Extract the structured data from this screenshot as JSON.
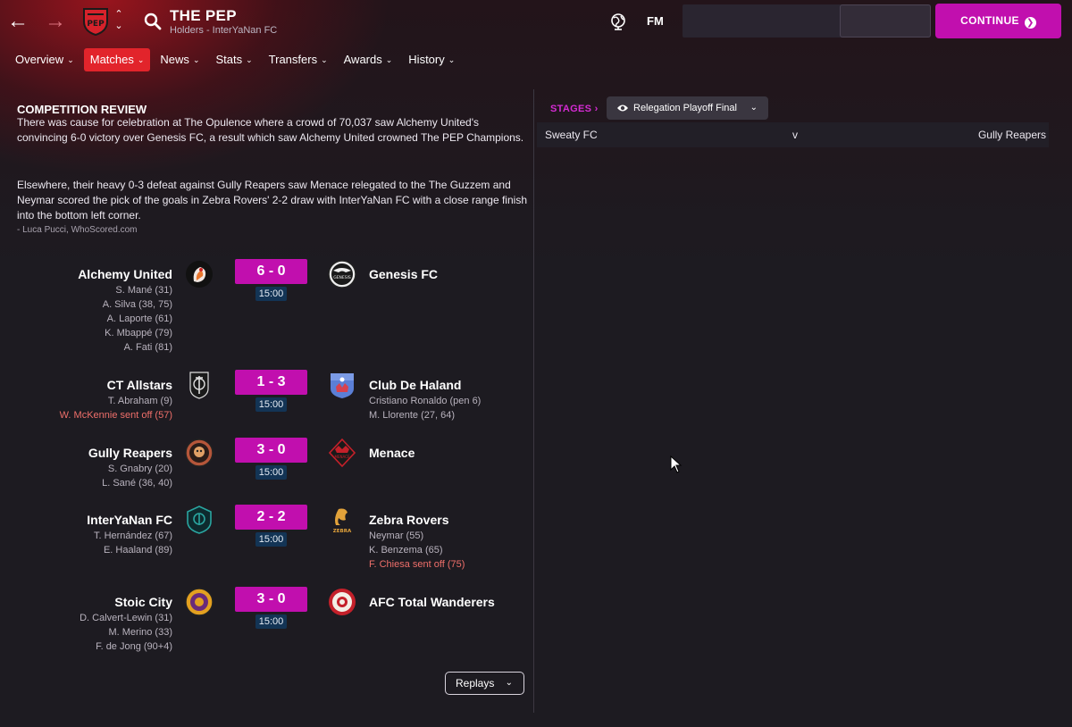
{
  "header": {
    "back_icon": "arrow-left-icon",
    "forward_icon": "arrow-right-icon",
    "title": "THE PEP",
    "subtitle": "Holders - InterYaNan FC",
    "fm_label": "FM",
    "continue_label": "CONTINUE",
    "accent_color": "#c10fae"
  },
  "tabs": [
    {
      "label": "Overview"
    },
    {
      "label": "Matches"
    },
    {
      "label": "News"
    },
    {
      "label": "Stats"
    },
    {
      "label": "Transfers"
    },
    {
      "label": "Awards"
    },
    {
      "label": "History"
    }
  ],
  "active_tab": "Matches",
  "review": {
    "title": "COMPETITION REVIEW",
    "paragraph1": "There was cause for celebration at The Opulence where a crowd of 70,037 saw Alchemy United's convincing 6-0 victory over Genesis FC, a result which saw Alchemy United crowned The PEP Champions.",
    "paragraph2": "Elsewhere, their heavy 0-3 defeat against Gully Reapers saw Menace relegated to the The Guzzem and Neymar scored the pick of the goals in Zebra Rovers' 2-2 draw with InterYaNan FC with a close range finish into the bottom left corner.",
    "author": "- Luca Pucci, WhoScored.com"
  },
  "fixtures": [
    {
      "home": "Alchemy United",
      "away": "Genesis FC",
      "score": "6 - 0",
      "time": "15:00",
      "home_events": [
        {
          "text": "S. Mané (31)",
          "red": false
        },
        {
          "text": "A. Silva (38, 75)",
          "red": false
        },
        {
          "text": "A. Laporte (61)",
          "red": false
        },
        {
          "text": "K. Mbappé (79)",
          "red": false
        },
        {
          "text": "A. Fati (81)",
          "red": false
        }
      ],
      "away_events": []
    },
    {
      "home": "CT Allstars",
      "away": "Club De Haland",
      "score": "1 - 3",
      "time": "15:00",
      "home_events": [
        {
          "text": "T. Abraham (9)",
          "red": false
        },
        {
          "text": "W. McKennie sent off (57)",
          "red": true
        }
      ],
      "away_events": [
        {
          "text": "Cristiano Ronaldo (pen 6)",
          "red": false
        },
        {
          "text": "M. Llorente (27, 64)",
          "red": false
        }
      ]
    },
    {
      "home": "Gully Reapers",
      "away": "Menace",
      "score": "3 - 0",
      "time": "15:00",
      "home_events": [
        {
          "text": "S. Gnabry (20)",
          "red": false
        },
        {
          "text": "L. Sané (36, 40)",
          "red": false
        }
      ],
      "away_events": []
    },
    {
      "home": "InterYaNan FC",
      "away": "Zebra Rovers",
      "score": "2 - 2",
      "time": "15:00",
      "home_events": [
        {
          "text": "T. Hernández (67)",
          "red": false
        },
        {
          "text": "E. Haaland (89)",
          "red": false
        }
      ],
      "away_events": [
        {
          "text": "Neymar (55)",
          "red": false
        },
        {
          "text": "K. Benzema (65)",
          "red": false
        },
        {
          "text": "F. Chiesa sent off (75)",
          "red": true
        }
      ]
    },
    {
      "home": "Stoic City",
      "away": "AFC Total Wanderers",
      "score": "3 - 0",
      "time": "15:00",
      "home_events": [
        {
          "text": "D. Calvert-Lewin (31)",
          "red": false
        },
        {
          "text": "M. Merino (33)",
          "red": false
        },
        {
          "text": "F. de Jong (90+4)",
          "red": false
        }
      ],
      "away_events": []
    }
  ],
  "replays_label": "Replays",
  "stages": {
    "label": "STAGES",
    "selected": "Relegation Playoff Final",
    "match": {
      "home": "Sweaty FC",
      "separator": "v",
      "away": "Gully Reapers"
    }
  }
}
